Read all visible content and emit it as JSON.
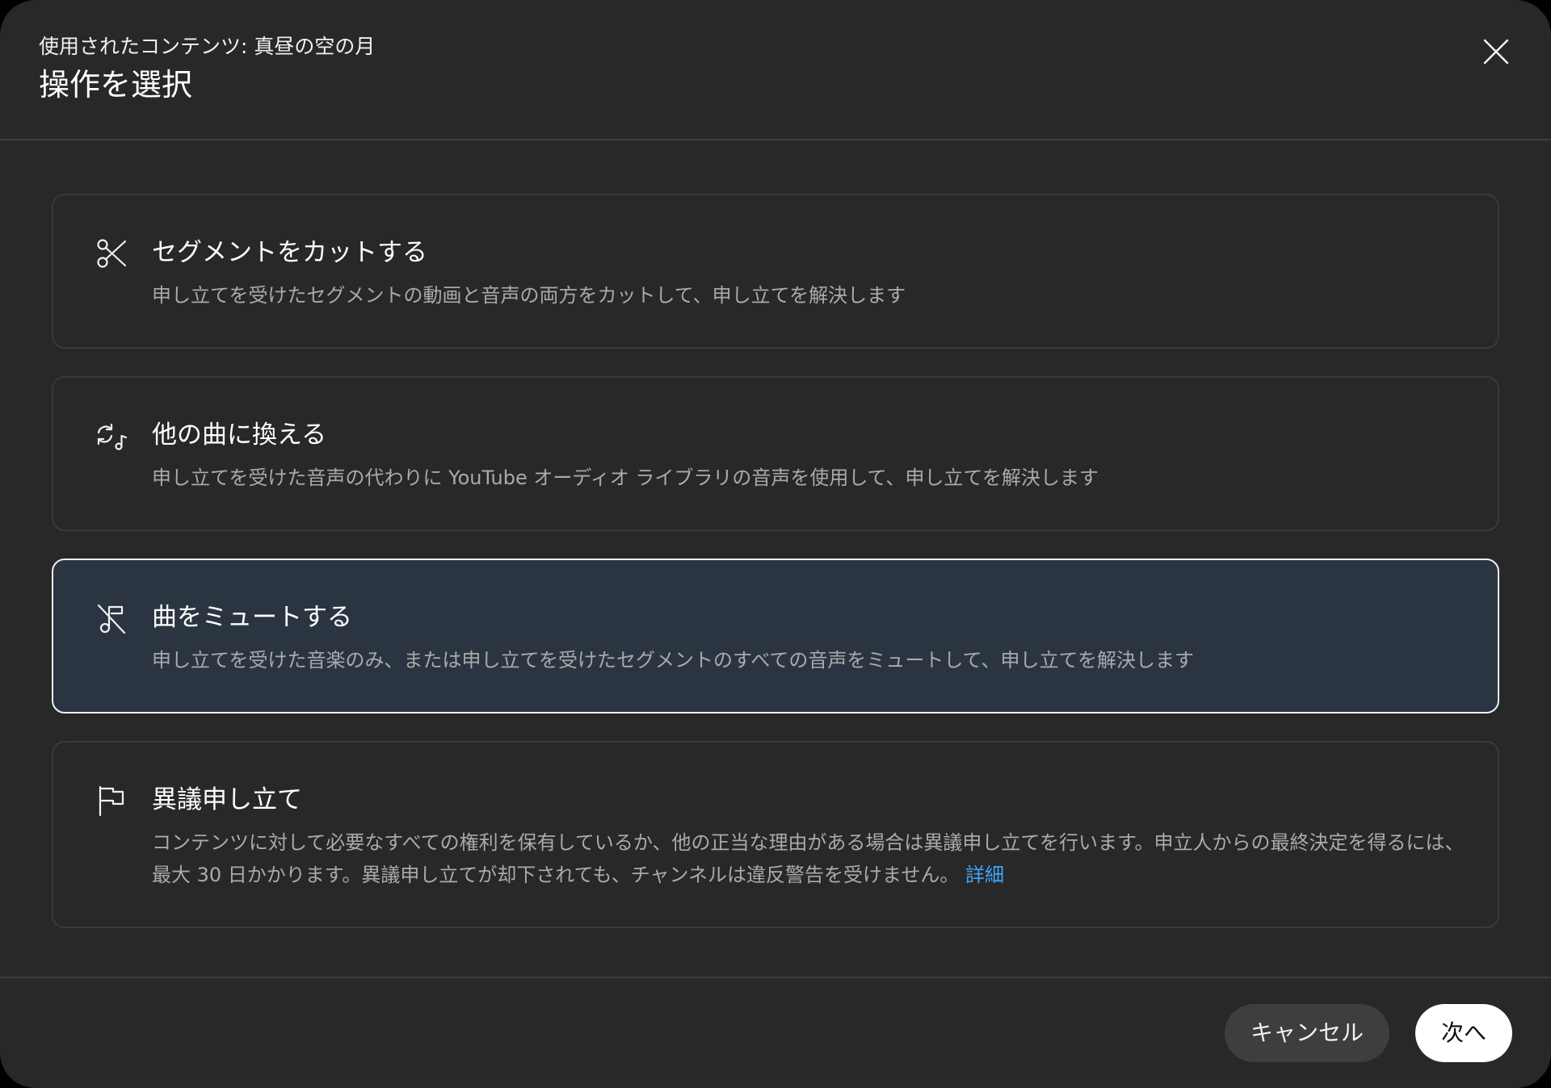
{
  "header": {
    "subtitle": "使用されたコンテンツ: 真昼の空の月",
    "title": "操作を選択",
    "close_icon": "close-icon"
  },
  "options": [
    {
      "icon": "scissors-icon",
      "title": "セグメントをカットする",
      "description": "申し立てを受けたセグメントの動画と音声の両方をカットして、申し立てを解決します",
      "selected": false
    },
    {
      "icon": "replace-song-icon",
      "title": "他の曲に換える",
      "description": "申し立てを受けた音声の代わりに YouTube オーディオ ライブラリの音声を使用して、申し立てを解決します",
      "selected": false
    },
    {
      "icon": "mute-music-icon",
      "title": "曲をミュートする",
      "description": "申し立てを受けた音楽のみ、または申し立てを受けたセグメントのすべての音声をミュートして、申し立てを解決します",
      "selected": true
    },
    {
      "icon": "flag-icon",
      "title": "異議申し立て",
      "description": "コンテンツに対して必要なすべての権利を保有しているか、他の正当な理由がある場合は異議申し立てを行います。申立人からの最終決定を得るには、最大 30 日かかります。異議申し立てが却下されても、チャンネルは違反警告を受けません。",
      "link": "詳細",
      "selected": false
    }
  ],
  "footer": {
    "cancel_label": "キャンセル",
    "next_label": "次へ"
  },
  "colors": {
    "background": "#282828",
    "selected_background": "#2b3542",
    "link": "#3ea6ff"
  }
}
